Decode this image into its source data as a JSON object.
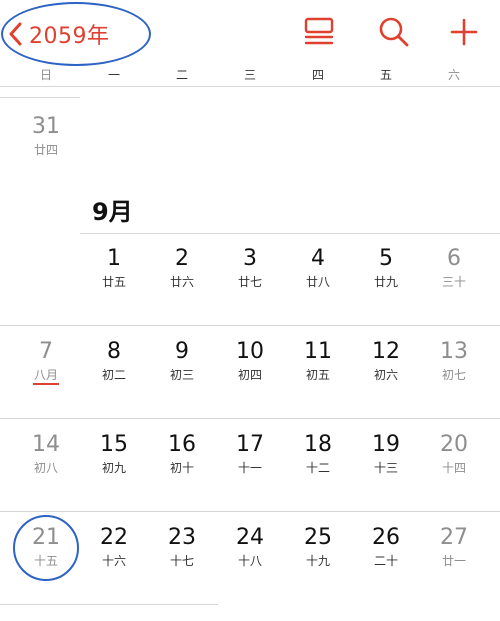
{
  "nav": {
    "year_label": "2059年",
    "icons": [
      "chevron-left-icon",
      "list-icon",
      "search-icon",
      "add-icon"
    ]
  },
  "weekdays": [
    "日",
    "一",
    "二",
    "三",
    "四",
    "五",
    "六"
  ],
  "prev_month_days": [
    {
      "day": "31",
      "lunar": "廿四"
    }
  ],
  "month": {
    "title": "9月",
    "weeks": [
      [
        {
          "day": "1",
          "lunar": "廿五"
        },
        {
          "day": "2",
          "lunar": "廿六"
        },
        {
          "day": "3",
          "lunar": "廿七"
        },
        {
          "day": "4",
          "lunar": "廿八"
        },
        {
          "day": "5",
          "lunar": "廿九"
        },
        {
          "day": "6",
          "lunar": "三十"
        }
      ],
      [
        {
          "day": "7",
          "lunar": "八月"
        },
        {
          "day": "8",
          "lunar": "初二"
        },
        {
          "day": "9",
          "lunar": "初三"
        },
        {
          "day": "10",
          "lunar": "初四"
        },
        {
          "day": "11",
          "lunar": "初五"
        },
        {
          "day": "12",
          "lunar": "初六"
        },
        {
          "day": "13",
          "lunar": "初七"
        }
      ],
      [
        {
          "day": "14",
          "lunar": "初八"
        },
        {
          "day": "15",
          "lunar": "初九"
        },
        {
          "day": "16",
          "lunar": "初十"
        },
        {
          "day": "17",
          "lunar": "十一"
        },
        {
          "day": "18",
          "lunar": "十二"
        },
        {
          "day": "19",
          "lunar": "十三"
        },
        {
          "day": "20",
          "lunar": "十四"
        }
      ],
      [
        {
          "day": "21",
          "lunar": "十五"
        },
        {
          "day": "22",
          "lunar": "十六"
        },
        {
          "day": "23",
          "lunar": "十七"
        },
        {
          "day": "24",
          "lunar": "十八"
        },
        {
          "day": "25",
          "lunar": "十九"
        },
        {
          "day": "26",
          "lunar": "二十"
        },
        {
          "day": "27",
          "lunar": "廿一"
        }
      ]
    ]
  },
  "colors": {
    "accent": "#e0402f",
    "annotation": "#2d63c4",
    "weekend_text": "#8e8e8e",
    "divider": "#d6d6d6"
  }
}
